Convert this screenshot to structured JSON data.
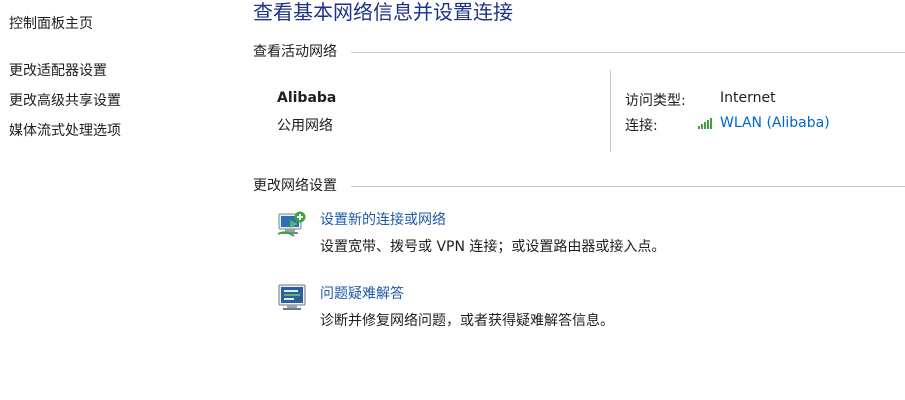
{
  "sidebar": {
    "items": [
      {
        "label": "控制面板主页"
      },
      {
        "label": "更改适配器设置"
      },
      {
        "label": "更改高级共享设置"
      },
      {
        "label": "媒体流式处理选项"
      }
    ]
  },
  "page": {
    "title": "查看基本网络信息并设置连接"
  },
  "active_networks": {
    "header": "查看活动网络",
    "network_name": "Alibaba",
    "network_type": "公用网络",
    "access_type_label": "访问类型:",
    "access_type_value": "Internet",
    "connections_label": "连接:",
    "connection_link": "WLAN (Alibaba)"
  },
  "change_settings": {
    "header": "更改网络设置",
    "tasks": [
      {
        "icon": "network-setup-icon",
        "link": "设置新的连接或网络",
        "description": "设置宽带、拨号或 VPN 连接；或设置路由器或接入点。"
      },
      {
        "icon": "troubleshoot-icon",
        "link": "问题疑难解答",
        "description": "诊断并修复网络问题，或者获得疑难解答信息。"
      }
    ]
  },
  "colors": {
    "title": "#1e3287",
    "link": "#1e5aa8",
    "connection_link": "#0066cc",
    "signal": "#3aa33a",
    "rule": "#c8c8c8"
  }
}
